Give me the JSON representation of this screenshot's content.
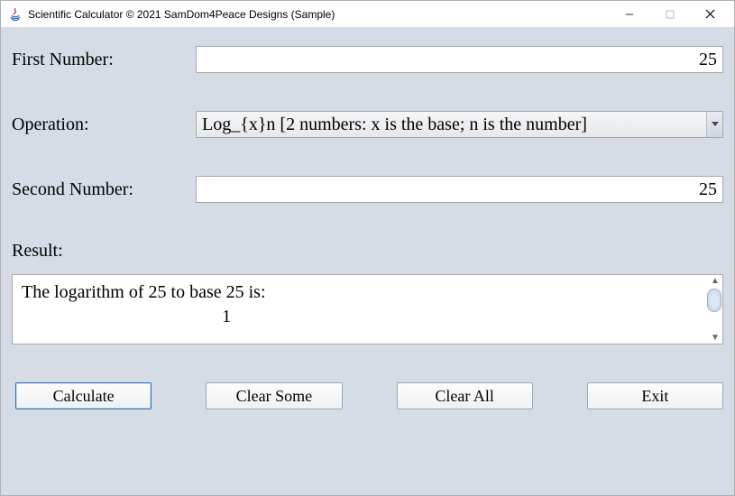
{
  "window": {
    "title": "Scientific Calculator © 2021 SamDom4Peace Designs (Sample)"
  },
  "labels": {
    "first_number": "First Number:",
    "operation": "Operation:",
    "second_number": "Second Number:",
    "result": "Result:"
  },
  "inputs": {
    "first_number": "25",
    "second_number": "25",
    "operation_selected": "Log_{x}n [2 numbers: x is the base; n is the number]"
  },
  "result": {
    "line1": "The logarithm of 25 to base 25 is:",
    "line2": "1"
  },
  "buttons": {
    "calculate": "Calculate",
    "clear_some": "Clear Some",
    "clear_all": "Clear All",
    "exit": "Exit"
  }
}
